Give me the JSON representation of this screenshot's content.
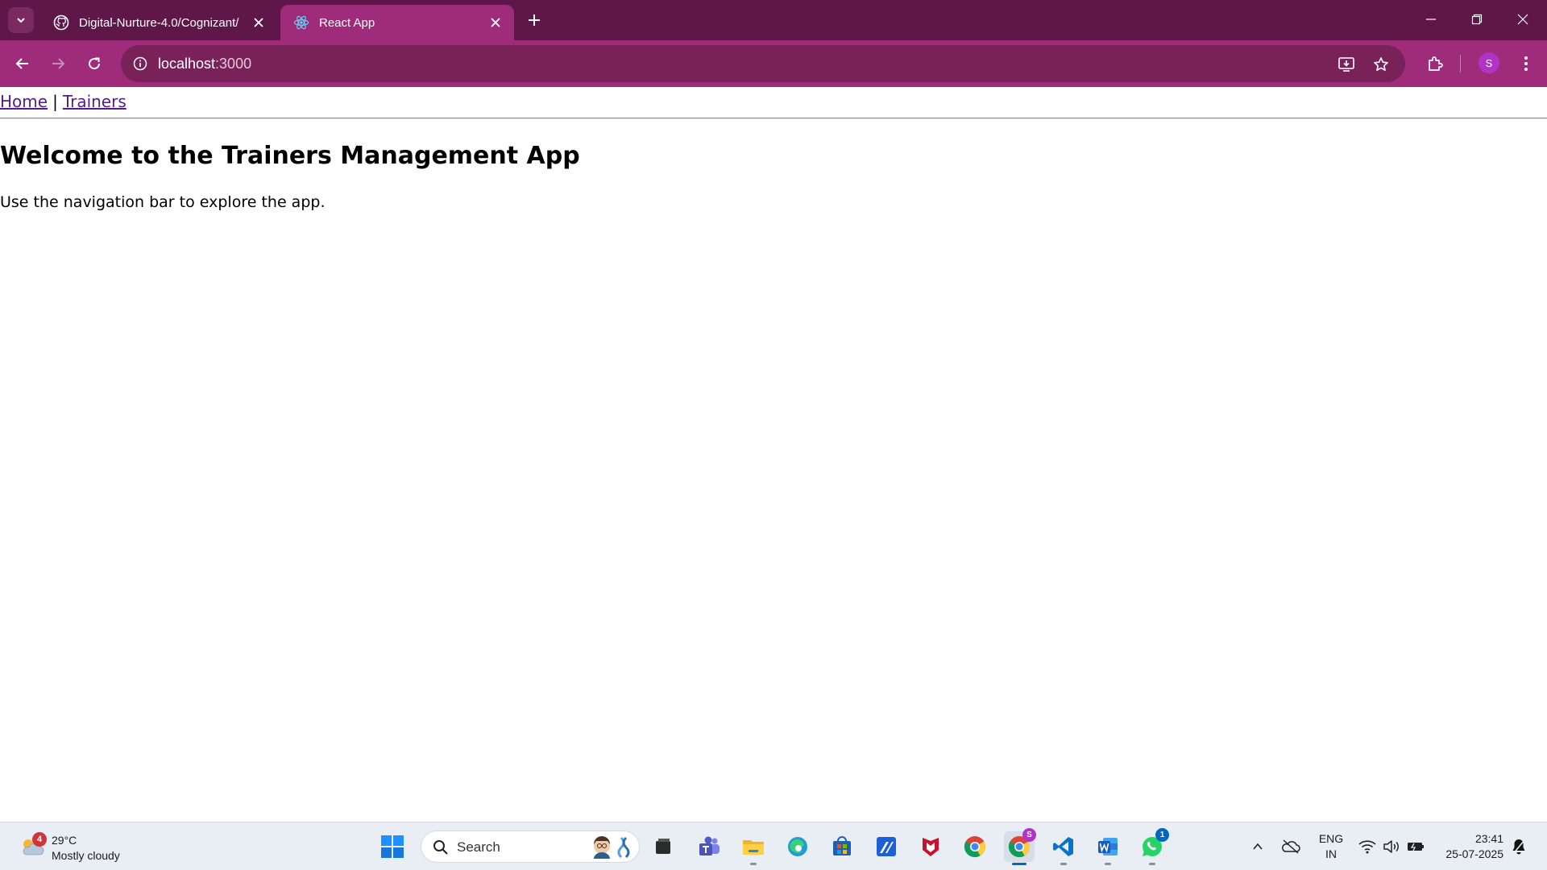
{
  "browser": {
    "tabs": [
      {
        "title": "Digital-Nurture-4.0/Cognizant/",
        "icon": "github-icon",
        "active": false
      },
      {
        "title": "React App",
        "icon": "react-icon",
        "active": true
      }
    ],
    "url_host": "localhost",
    "url_port": ":3000",
    "profile_initial": "S",
    "colors": {
      "tabstrip": "#5f1648",
      "toolbar": "#9e2c7a",
      "omnibox": "#792259"
    }
  },
  "page": {
    "nav": {
      "home": "Home",
      "separator": "|",
      "trainers": "Trainers"
    },
    "heading": "Welcome to the Trainers Management App",
    "paragraph": "Use the navigation bar to explore the app."
  },
  "taskbar": {
    "weather": {
      "badge": "4",
      "temp": "29°C",
      "condition": "Mostly cloudy"
    },
    "search_label": "Search",
    "apps": [
      "file-explorer-dark-icon",
      "teams-icon",
      "folder-icon",
      "edge-icon",
      "store-icon",
      "app-icon",
      "mcafee-icon",
      "chrome-icon",
      "chrome-profile-icon",
      "vscode-icon",
      "word-icon",
      "whatsapp-icon"
    ],
    "chrome_profile_badge": "S",
    "whatsapp_badge": "1",
    "lang_line1": "ENG",
    "lang_line2": "IN",
    "time": "23:41",
    "date": "25-07-2025"
  }
}
